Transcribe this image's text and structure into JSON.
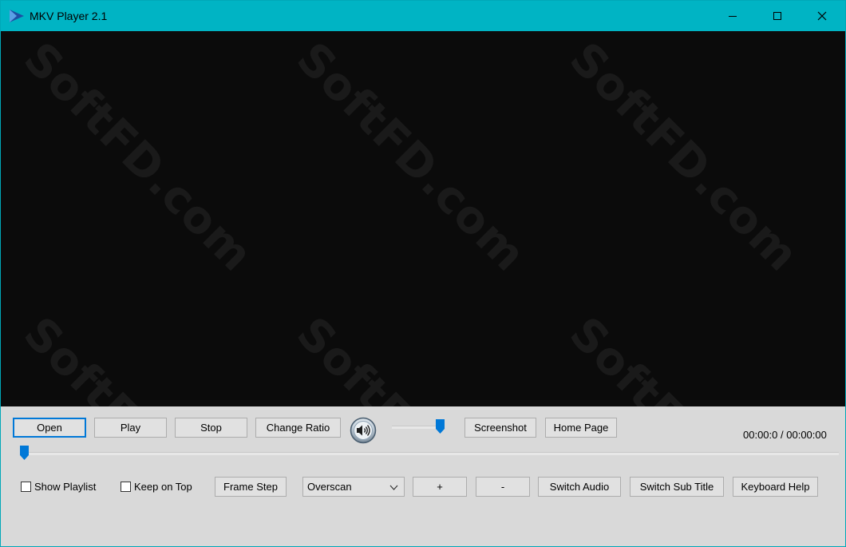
{
  "window": {
    "title": "MKV Player 2.1",
    "accent_color": "#00b4c4",
    "icon": "play-logo-icon",
    "controls": [
      "minimize-icon",
      "maximize-icon",
      "close-icon"
    ]
  },
  "watermark_text": "SoftFD.com",
  "buttons": {
    "open": "Open",
    "play": "Play",
    "stop": "Stop",
    "change_ratio": "Change Ratio",
    "screenshot": "Screenshot",
    "home_page": "Home Page",
    "frame_step": "Frame Step",
    "zoom_in": "+",
    "zoom_out": "-",
    "switch_audio": "Switch Audio",
    "switch_sub_title": "Switch Sub Title",
    "keyboard_help": "Keyboard Help"
  },
  "volume": {
    "icon": "speaker-icon",
    "level_fraction": 1.0
  },
  "seek": {
    "position_fraction": 0.0
  },
  "time": {
    "current": "00:00:0",
    "separator": "/",
    "total": "00:00:00"
  },
  "checkboxes": {
    "show_playlist": {
      "label": "Show Playlist",
      "checked": false
    },
    "keep_on_top": {
      "label": "Keep on Top",
      "checked": false
    }
  },
  "display_mode": {
    "selected": "Overscan"
  }
}
